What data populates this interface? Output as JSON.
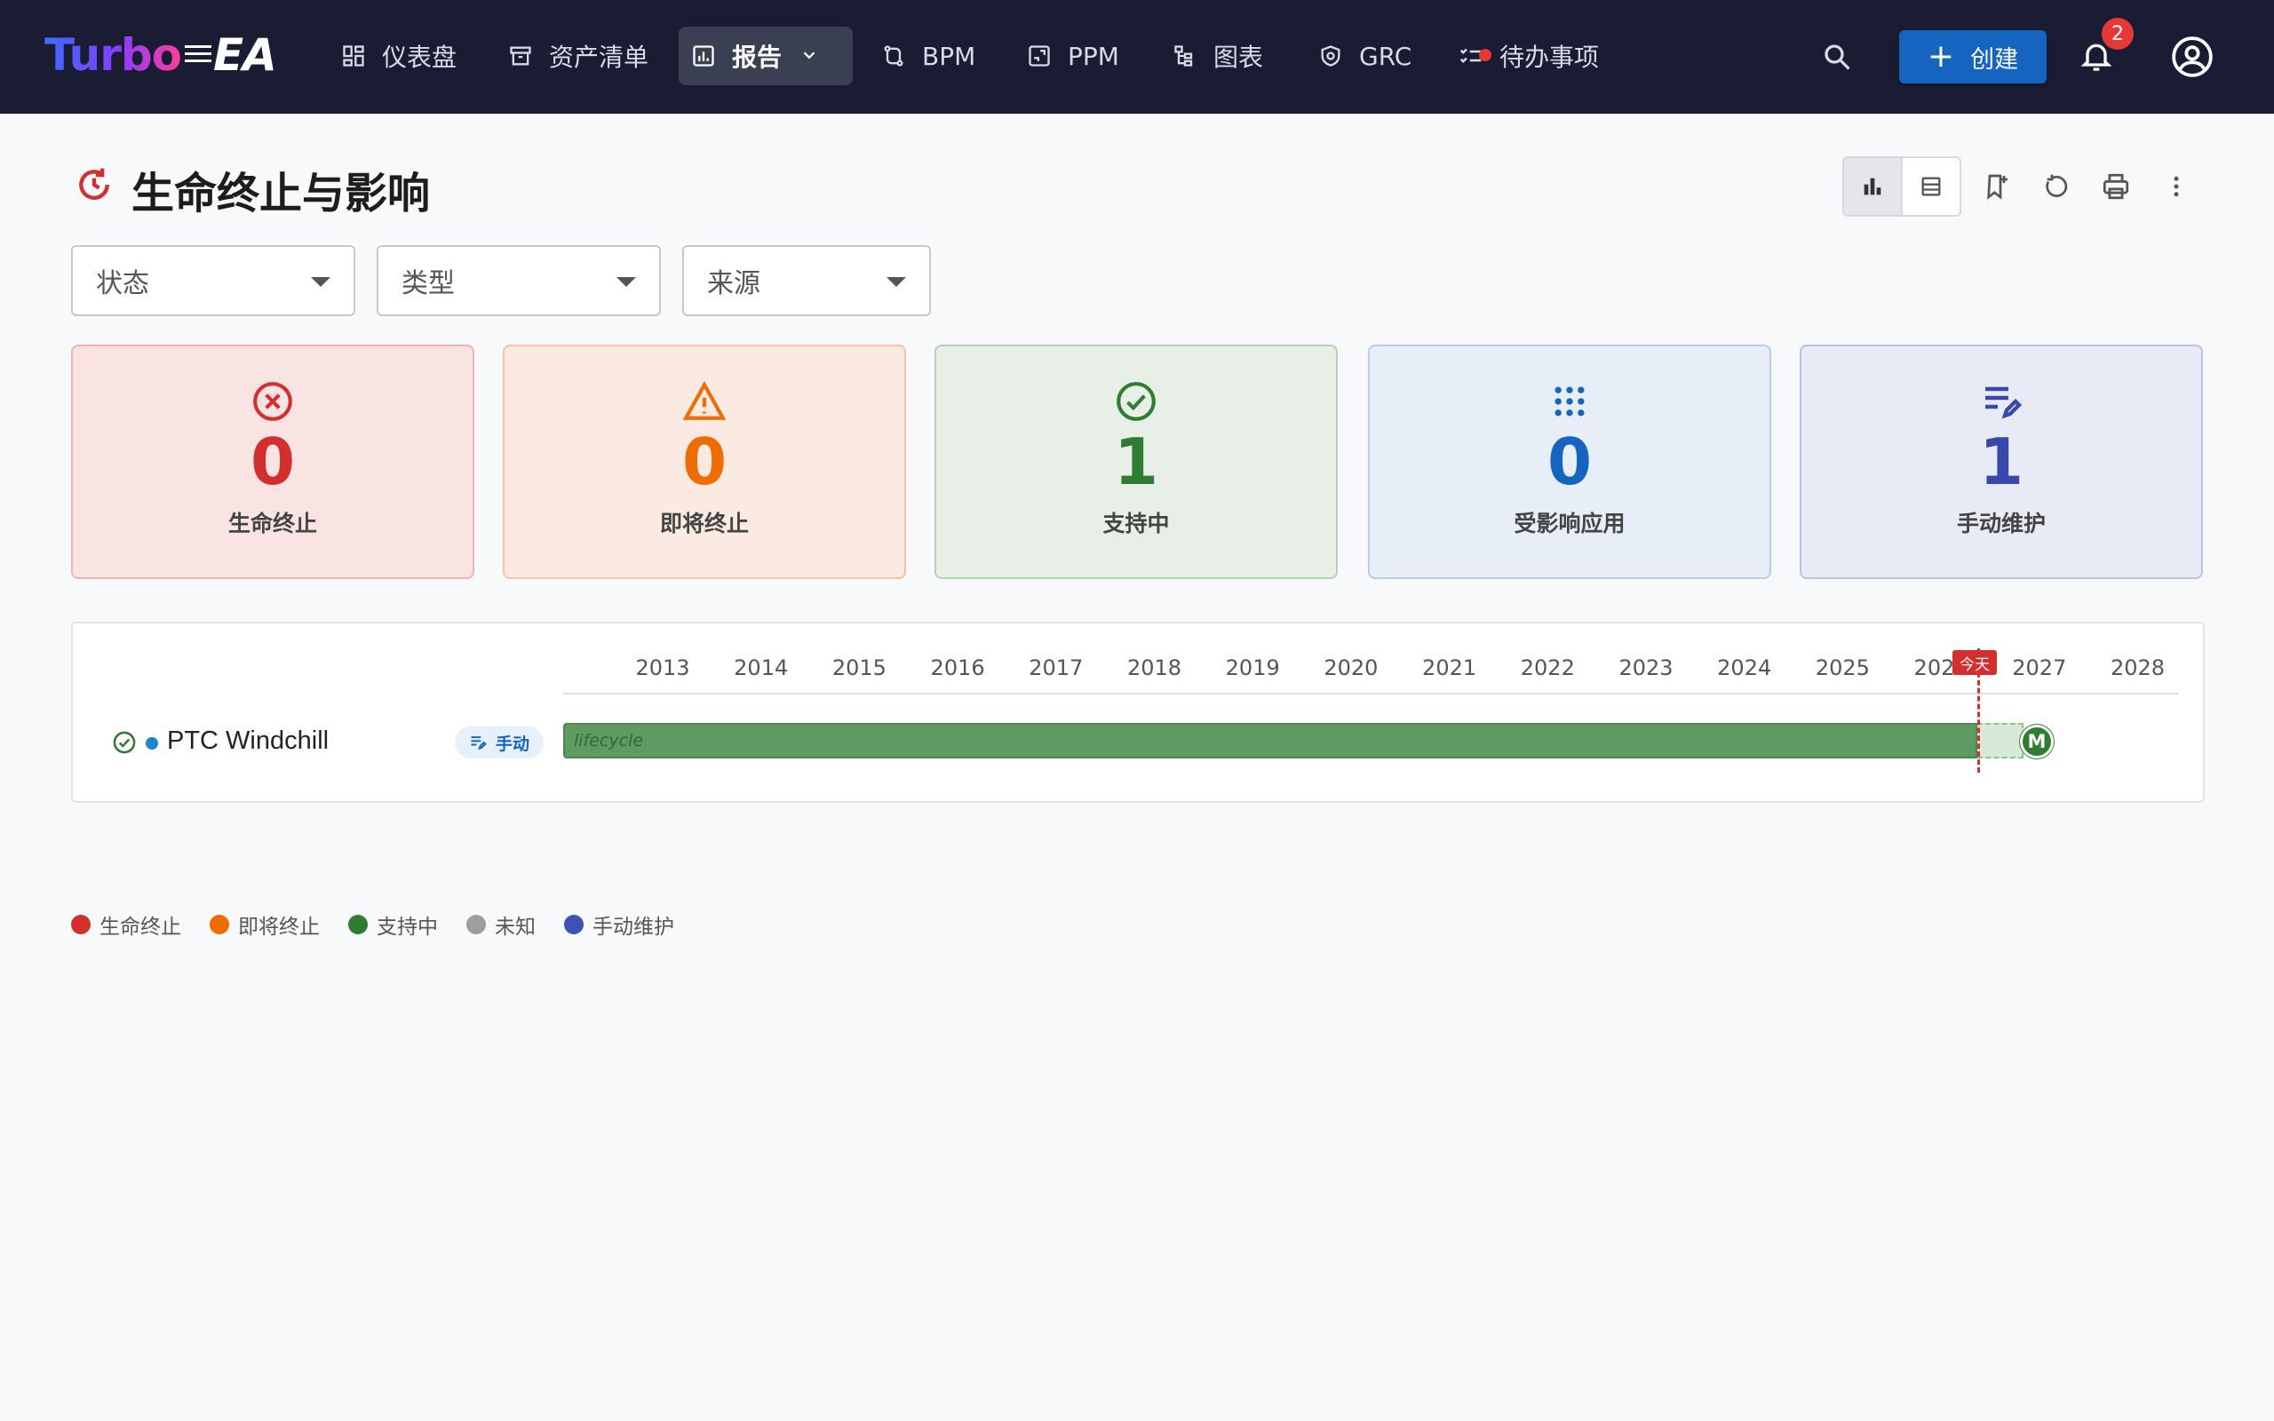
{
  "app": {
    "logo_turbo": "Turbo",
    "logo_ea": "EA"
  },
  "nav": {
    "items": [
      {
        "label": "仪表盘",
        "icon": "dashboard-icon"
      },
      {
        "label": "资产清单",
        "icon": "inventory-icon"
      },
      {
        "label": "报告",
        "icon": "report-icon",
        "active": true
      },
      {
        "label": "BPM",
        "icon": "bpm-icon"
      },
      {
        "label": "PPM",
        "icon": "ppm-icon"
      },
      {
        "label": "图表",
        "icon": "diagram-icon"
      },
      {
        "label": "GRC",
        "icon": "grc-icon"
      },
      {
        "label": "待办事项",
        "icon": "todo-icon"
      }
    ],
    "create_label": "创建",
    "notification_count": "2"
  },
  "page": {
    "title": "生命终止与影响"
  },
  "filters": {
    "status": "状态",
    "type": "类型",
    "source": "来源"
  },
  "stats": [
    {
      "value": "0",
      "label": "生命终止",
      "color": "#d32f2f"
    },
    {
      "value": "0",
      "label": "即将终止",
      "color": "#ef6c00"
    },
    {
      "value": "1",
      "label": "支持中",
      "color": "#2e7d32"
    },
    {
      "value": "0",
      "label": "受影响应用",
      "color": "#1565c0"
    },
    {
      "value": "1",
      "label": "手动维护",
      "color": "#3949ab"
    }
  ],
  "timeline": {
    "years": [
      "2013",
      "2014",
      "2015",
      "2016",
      "2017",
      "2018",
      "2019",
      "2020",
      "2021",
      "2022",
      "2023",
      "2024",
      "2025",
      "2026",
      "2027",
      "2028"
    ],
    "today_label": "今天",
    "rows": [
      {
        "name": "PTC Windchill",
        "chip": "手动",
        "bar_label": "lifecycle",
        "milestone": "M"
      }
    ]
  },
  "legend": [
    {
      "label": "生命终止",
      "color": "#d32f2f"
    },
    {
      "label": "即将终止",
      "color": "#ef6c00"
    },
    {
      "label": "支持中",
      "color": "#2e7d32"
    },
    {
      "label": "未知",
      "color": "#9e9e9e"
    },
    {
      "label": "手动维护",
      "color": "#3f51b5"
    }
  ]
}
